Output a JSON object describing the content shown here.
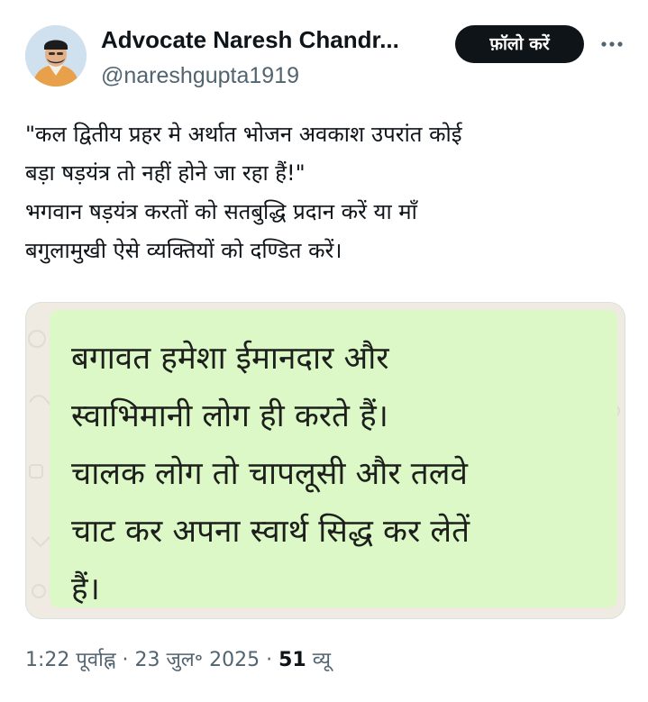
{
  "author": {
    "display_name": "Advocate Naresh Chandr...",
    "handle": "@nareshgupta1919",
    "avatar_icon": "profile-photo"
  },
  "header": {
    "follow_label": "फ़ॉलो करें",
    "more_icon": "more-horizontal-icon"
  },
  "tweet": {
    "lines": [
      "\"कल द्वितीय प्रहर मे  अर्थात भोजन अवकाश उपरांत कोई",
      "बड़ा षड़यंत्र तो नहीं होने जा रहा हैं!\"",
      "भगवान षड़यंत्र करतों को सतबुद्धि प्रदान करें या माँ",
      "बगुलामुखी ऐसे  व्यक्तियों को दण्डित करें।"
    ]
  },
  "media": {
    "bubble_lines": [
      "बगावत हमेशा ईमानदार और",
      "स्वाभिमानी लोग ही करते हैं।",
      "चालक लोग तो चापलूसी और तलवे",
      "चाट कर अपना स्वार्थ सिद्ध कर लेतें",
      "हैं।"
    ],
    "bubble_color": "#dcf8c6",
    "chat_background_color": "#efeae2"
  },
  "meta": {
    "time": "1:22 पूर्वाह्न",
    "separator": " · ",
    "date": "23 जुल॰ 2025",
    "views_count": "51",
    "views_label": " व्यू"
  },
  "colors": {
    "text_primary": "#0f1419",
    "text_secondary": "#536471",
    "follow_button_bg": "#0f1419"
  }
}
